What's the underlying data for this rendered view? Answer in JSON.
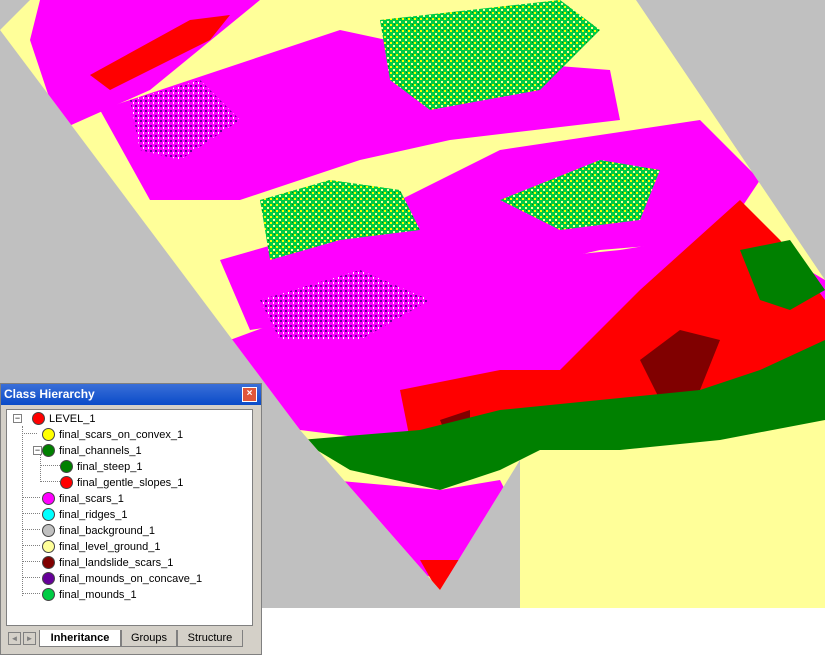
{
  "panel": {
    "title": "Class Hierarchy",
    "close_icon": "close-icon",
    "tree": [
      {
        "label": "LEVEL_1",
        "color": "#ff0000",
        "depth": 0,
        "expander": "−"
      },
      {
        "label": "final_scars_on_convex_1",
        "color": "#ffff00",
        "depth": 1
      },
      {
        "label": "final_channels_1",
        "color": "#008000",
        "depth": 1,
        "expander": "−"
      },
      {
        "label": "final_steep_1",
        "color": "#008000",
        "depth": 2
      },
      {
        "label": "final_gentle_slopes_1",
        "color": "#ff0000",
        "depth": 2
      },
      {
        "label": "final_scars_1",
        "color": "#ff00ff",
        "depth": 1
      },
      {
        "label": "final_ridges_1",
        "color": "#00ffff",
        "depth": 1
      },
      {
        "label": "final_background_1",
        "color": "#c0c0c0",
        "depth": 1
      },
      {
        "label": "final_level_ground_1",
        "color": "#ffff99",
        "depth": 1
      },
      {
        "label": "final_landslide_scars_1",
        "color": "#800000",
        "depth": 1
      },
      {
        "label": "final_mounds_on_concave_1",
        "color": "#660099",
        "depth": 1
      },
      {
        "label": "final_mounds_1",
        "color": "#00cc44",
        "depth": 1
      }
    ],
    "tabs": [
      {
        "label": "Inheritance",
        "active": true
      },
      {
        "label": "Groups",
        "active": false
      },
      {
        "label": "Structure",
        "active": false
      }
    ]
  },
  "map": {
    "background": "#c0c0c0",
    "class_colors": {
      "level_ground": "#ffff99",
      "scars": "#ff00ff",
      "gentle_slopes": "#ff0000",
      "steep": "#008000",
      "landslide_scars": "#800000",
      "mounds_on_concave": "#660099",
      "mounds": "#00cc44",
      "scars_on_convex": "#ffff00"
    }
  }
}
